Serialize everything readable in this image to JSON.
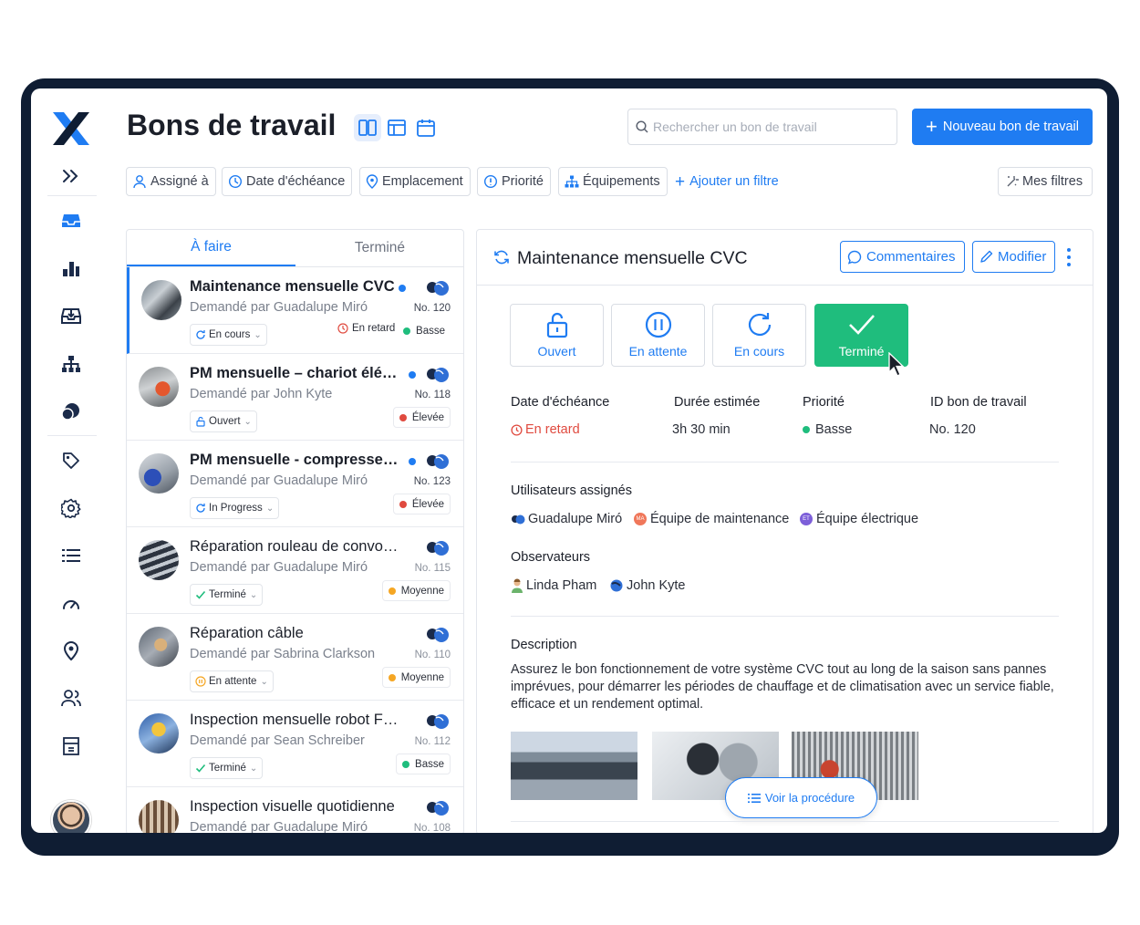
{
  "header": {
    "title": "Bons de travail",
    "search_placeholder": "Rechercher un bon de travail",
    "new_button": "Nouveau bon de travail"
  },
  "filters": {
    "assigned": "Assigné à",
    "due_date": "Date d'échéance",
    "location": "Emplacement",
    "priority": "Priorité",
    "equipment": "Équipements",
    "add_filter": "Ajouter un filtre",
    "my_filters": "Mes filtres"
  },
  "tabs": {
    "todo": "À faire",
    "done": "Terminé"
  },
  "work_orders": [
    {
      "title": "Maintenance mensuelle CVC",
      "requested_by": "Demandé par Guadalupe Miró",
      "number": "No. 120",
      "status": "En cours",
      "late": "En retard",
      "priority": "Basse"
    },
    {
      "title": "PM mensuelle – chariot élévateur",
      "requested_by": "Demandé par John Kyte",
      "number": "No. 118",
      "status": "Ouvert",
      "priority": "Élevée"
    },
    {
      "title": "PM mensuelle - compresseur d'air",
      "requested_by": "Demandé par Guadalupe Miró",
      "number": "No. 123",
      "status": "In Progress",
      "priority": "Élevée"
    },
    {
      "title": "Réparation rouleau de convoyeur",
      "requested_by": "Demandé par Guadalupe Miró",
      "number": "No. 115",
      "status": "Terminé",
      "priority": "Moyenne"
    },
    {
      "title": "Réparation câble",
      "requested_by": "Demandé par Sabrina Clarkson",
      "number": "No. 110",
      "status": "En attente",
      "priority": "Moyenne"
    },
    {
      "title": "Inspection mensuelle robot Fanuc",
      "requested_by": "Demandé par Sean Schreiber",
      "number": "No. 112",
      "status": "Terminé",
      "priority": "Basse"
    },
    {
      "title": "Inspection visuelle quotidienne",
      "requested_by": "Demandé par Guadalupe Miró",
      "number": "No. 108"
    }
  ],
  "detail": {
    "title": "Maintenance mensuelle CVC",
    "comments_button": "Commentaires",
    "edit_button": "Modifier",
    "states": {
      "open": "Ouvert",
      "on_hold": "En attente",
      "in_progress": "En cours",
      "done": "Terminé"
    },
    "due_label": "Date d'échéance",
    "due_value": "En retard",
    "duration_label": "Durée estimée",
    "duration_value": "3h 30 min",
    "priority_label": "Priorité",
    "priority_value": "Basse",
    "id_label": "ID bon de travail",
    "id_value": "No. 120",
    "assigned_label": "Utilisateurs assignés",
    "assigned": {
      "user": "Guadalupe Miró",
      "team1": "Équipe de maintenance",
      "team1_initials": "MA",
      "team2": "Équipe électrique",
      "team2_initials": "ET"
    },
    "observers_label": "Observateurs",
    "observers": [
      "Linda Pham",
      "John Kyte"
    ],
    "description_label": "Description",
    "description": "Assurez le bon fonctionnement de votre système CVC tout au long de la saison sans pannes imprévues, pour démarrer les périodes de chauffage et de climatisation avec un service fiable, efficace et un rendement optimal.",
    "procedure_button": "Voir la procédure"
  },
  "colors": {
    "accent": "#1f7cf2",
    "success": "#1fbd7d",
    "danger": "#e04a3f",
    "warning": "#f5a623",
    "frame": "#0f1d33"
  }
}
